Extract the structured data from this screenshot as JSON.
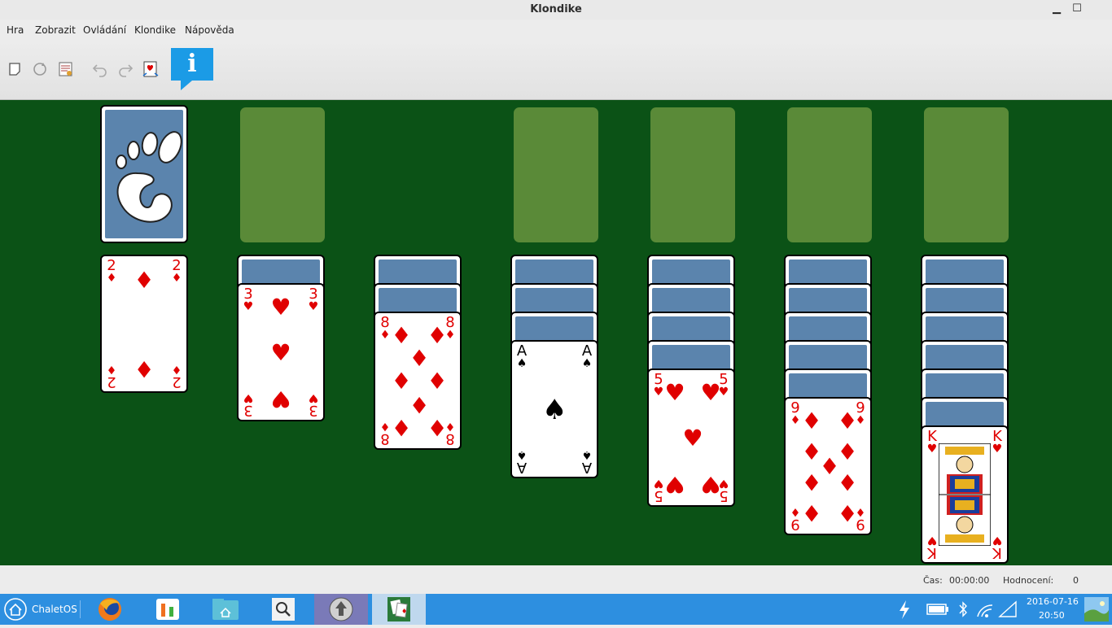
{
  "window": {
    "title": "Klondike",
    "minimize_icon": "minimize-icon",
    "maximize_icon": "maximize-icon"
  },
  "menu": [
    "Hra",
    "Zobrazit",
    "Ovládání",
    "Klondike",
    "Nápověda"
  ],
  "toolbar": [
    "new-game-icon",
    "restart-icon",
    "select-game-icon",
    "undo-icon",
    "redo-icon",
    "hint-icon",
    "info-icon"
  ],
  "info_glyph": "i",
  "foundation_piles": 4,
  "tableau": [
    {
      "hidden": 0,
      "visible": [
        {
          "rank": "2",
          "suit": "♦",
          "color": "red"
        }
      ]
    },
    {
      "hidden": 1,
      "visible": [
        {
          "rank": "3",
          "suit": "♥",
          "color": "red"
        }
      ]
    },
    {
      "hidden": 2,
      "visible": [
        {
          "rank": "8",
          "suit": "♦",
          "color": "red"
        }
      ]
    },
    {
      "hidden": 3,
      "visible": [
        {
          "rank": "A",
          "suit": "♠",
          "color": "black"
        }
      ]
    },
    {
      "hidden": 4,
      "visible": [
        {
          "rank": "5",
          "suit": "♥",
          "color": "red"
        }
      ]
    },
    {
      "hidden": 5,
      "visible": [
        {
          "rank": "9",
          "suit": "♦",
          "color": "red"
        }
      ]
    },
    {
      "hidden": 6,
      "visible": [
        {
          "rank": "K",
          "suit": "♥",
          "color": "red"
        }
      ]
    }
  ],
  "status": {
    "time_label": "Čas:",
    "time_value": "00:00:00",
    "score_label": "Hodnocení:",
    "score_value": "0"
  },
  "taskbar": {
    "start_label": "ChaletOS",
    "date": "2016-07-16",
    "time": "20:50",
    "apps": [
      "firefox-icon",
      "system-monitor-icon",
      "file-manager-icon",
      "search-icon",
      "update-icon",
      "solitaire-icon"
    ],
    "tray": [
      "power-icon",
      "battery-icon",
      "bluetooth-icon",
      "wifi-icon",
      "signal-icon"
    ]
  },
  "colors": {
    "felt": "#0b5216",
    "slot": "#5a8a38",
    "card_back": "#5b84ad",
    "taskbar": "#2d8fe0",
    "info": "#1b9be6"
  }
}
